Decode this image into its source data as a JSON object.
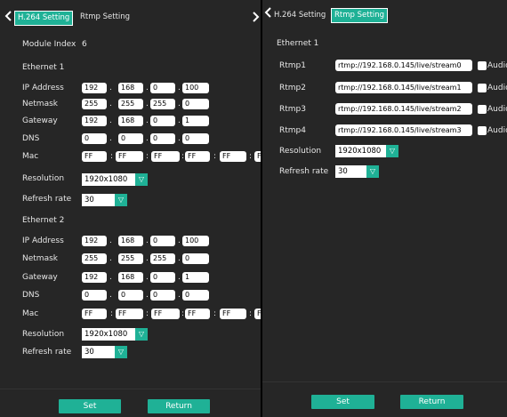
{
  "colors": {
    "accent": "#1fb196",
    "panel": "#262626",
    "field": "#ffffff"
  },
  "left": {
    "tabs": [
      {
        "label": "H.264 Setting",
        "active": true
      },
      {
        "label": "Rtmp Setting",
        "active": false
      }
    ],
    "module_index_label": "Module Index",
    "module_index_value": "6",
    "eth1": {
      "title": "Ethernet 1",
      "ip_label": "IP Address",
      "ip": [
        "192",
        "168",
        "0",
        "100"
      ],
      "netmask_label": "Netmask",
      "netmask": [
        "255",
        "255",
        "255",
        "0"
      ],
      "gateway_label": "Gateway",
      "gateway": [
        "192",
        "168",
        "0",
        "1"
      ],
      "dns_label": "DNS",
      "dns": [
        "0",
        "0",
        "0",
        "0"
      ],
      "mac_label": "Mac",
      "mac": [
        "FF",
        "FF",
        "FF",
        "FF",
        "FF",
        "FF"
      ],
      "resolution_label": "Resolution",
      "resolution": "1920x1080",
      "refresh_label": "Refresh rate",
      "refresh": "30"
    },
    "eth2": {
      "title": "Ethernet 2",
      "ip_label": "IP Address",
      "ip": [
        "192",
        "168",
        "0",
        "100"
      ],
      "netmask_label": "Netmask",
      "netmask": [
        "255",
        "255",
        "255",
        "0"
      ],
      "gateway_label": "Gateway",
      "gateway": [
        "192",
        "168",
        "0",
        "1"
      ],
      "dns_label": "DNS",
      "dns": [
        "0",
        "0",
        "0",
        "0"
      ],
      "mac_label": "Mac",
      "mac": [
        "FF",
        "FF",
        "FF",
        "FF",
        "FF",
        "FF"
      ],
      "resolution_label": "Resolution",
      "resolution": "1920x1080",
      "refresh_label": "Refresh rate",
      "refresh": "30"
    },
    "set_label": "Set",
    "return_label": "Return"
  },
  "right": {
    "tabs": [
      {
        "label": "H.264 Setting",
        "active": false
      },
      {
        "label": "Rtmp Setting",
        "active": true
      }
    ],
    "eth1_title": "Ethernet 1",
    "rtmp": [
      {
        "label": "Rtmp1",
        "url": "rtmp://192.168.0.145/live/stream0",
        "audio": "Audio"
      },
      {
        "label": "Rtmp2",
        "url": "rtmp://192.168.0.145/live/stream1",
        "audio": "Audio"
      },
      {
        "label": "Rtmp3",
        "url": "rtmp://192.168.0.145/live/stream2",
        "audio": "Audio"
      },
      {
        "label": "Rtmp4",
        "url": "rtmp://192.168.0.145/live/stream3",
        "audio": "Audio"
      }
    ],
    "resolution_label": "Resolution",
    "resolution": "1920x1080",
    "refresh_label": "Refresh rate",
    "refresh": "30",
    "set_label": "Set",
    "return_label": "Return"
  }
}
